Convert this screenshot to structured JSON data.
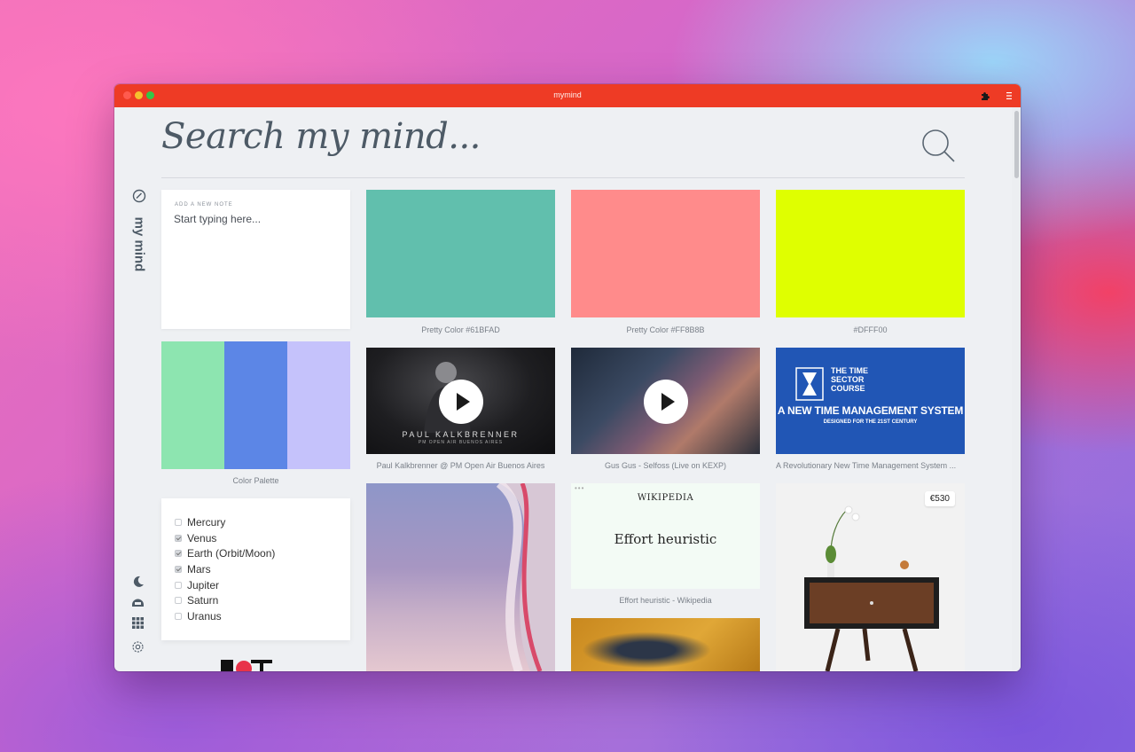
{
  "window": {
    "title": "mymind"
  },
  "search": {
    "placeholder": "Search my mind..."
  },
  "brand": {
    "name": "my mind"
  },
  "note": {
    "label": "ADD A NEW NOTE",
    "placeholder": "Start typing here..."
  },
  "palette": {
    "caption": "Color Palette",
    "swatches": [
      "#8de5b0",
      "#5c86e6",
      "#c5c2fb"
    ]
  },
  "colors": [
    {
      "hex": "#61BFAD",
      "caption": "Pretty Color #61BFAD"
    },
    {
      "hex": "#FF8B8B",
      "caption": "Pretty Color #FF8B8B"
    },
    {
      "hex": "#DFFF00",
      "caption": "#DFFF00"
    }
  ],
  "checklist": [
    {
      "label": "Mercury",
      "checked": false
    },
    {
      "label": "Venus",
      "checked": true
    },
    {
      "label": "Earth (Orbit/Moon)",
      "checked": true
    },
    {
      "label": "Mars",
      "checked": true
    },
    {
      "label": "Jupiter",
      "checked": false
    },
    {
      "label": "Saturn",
      "checked": false
    },
    {
      "label": "Uranus",
      "checked": false
    }
  ],
  "videos": [
    {
      "caption": "Paul Kalkbrenner @ PM Open Air Buenos Aires",
      "overlay_title": "PAUL KALKBRENNER",
      "overlay_sub": "PM OPEN AIR BUENOS AIRES"
    },
    {
      "caption": "Gus Gus - Selfoss (Live on KEXP)"
    }
  ],
  "course": {
    "caption": "A Revolutionary New Time Management System ...",
    "head": "THE TIME SECTOR COURSE",
    "title": "A NEW TIME MANAGEMENT SYSTEM",
    "sub": "DESIGNED FOR THE 21ST CENTURY"
  },
  "wiki": {
    "logo": "WIKIPEDIA",
    "title": "Effort heuristic",
    "caption": "Effort heuristic - Wikipedia"
  },
  "product": {
    "price": "€530"
  },
  "icons": {
    "sidebar": [
      "moon-icon",
      "helmet-icon",
      "grid-icon",
      "settings-icon"
    ],
    "titlebar": [
      "puzzle-icon",
      "menu-icon"
    ]
  }
}
